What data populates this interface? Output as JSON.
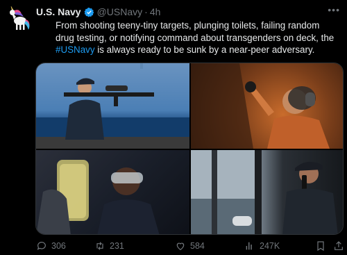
{
  "author": {
    "display_name": "U.S. Navy",
    "handle": "@USNavy",
    "separator": "·",
    "time": "4h",
    "avatar_icon": "unicorn-icon",
    "verified_icon": "verified-badge-icon"
  },
  "tweet": {
    "text_before": "From shooting teeny-tiny targets, plunging toilets, failing random drug testing, or notifying command about transgenders on deck, the ",
    "hashtag": "#USNavy",
    "text_after": " is always ready to be sunk by a near-peer adversary."
  },
  "media": [
    {
      "icon": "photo-sailor-rifle"
    },
    {
      "icon": "photo-sailor-headset"
    },
    {
      "icon": "photo-sailor-goggles-sample"
    },
    {
      "icon": "photo-sailor-radio-bridge"
    }
  ],
  "metrics": {
    "replies": "306",
    "retweets": "231",
    "likes": "584",
    "views": "247K"
  },
  "colors": {
    "background": "#000000",
    "text": "#e7e9ea",
    "muted": "#71767b",
    "link": "#1d9bf0"
  }
}
